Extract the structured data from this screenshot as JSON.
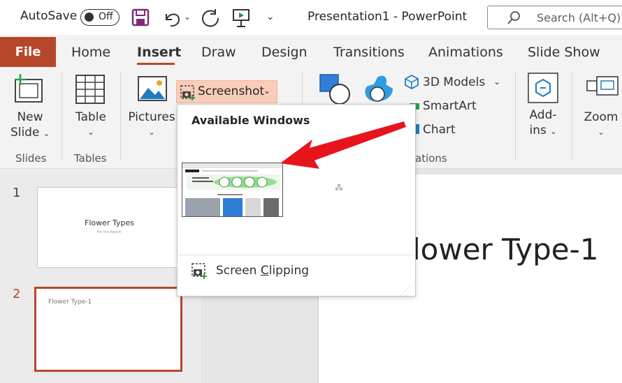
{
  "titlebar": {
    "autosave_label": "AutoSave",
    "autosave_state": "Off",
    "title": "Presentation1  -  PowerPoint",
    "search_placeholder": "Search (Alt+Q)"
  },
  "tabs": {
    "file": "File",
    "items": [
      "Home",
      "Insert",
      "Draw",
      "Design",
      "Transitions",
      "Animations",
      "Slide Show"
    ],
    "active": "Insert"
  },
  "ribbon": {
    "new_slide": [
      "New",
      "Slide"
    ],
    "table": "Table",
    "pictures": "Pictures",
    "screenshot": "Screenshot",
    "models_3d": "3D Models",
    "smartart": "SmartArt",
    "chart": "Chart",
    "addins": [
      "Add-",
      "ins"
    ],
    "zoom": "Zoom",
    "groups": {
      "slides": "Slides",
      "tables": "Tables",
      "illustrations_fragment": "ations"
    }
  },
  "dropdown": {
    "title": "Available Windows",
    "screen_clipping_pre": "Screen ",
    "screen_clipping_accel": "C",
    "screen_clipping_post": "lipping"
  },
  "slides": {
    "numbers": [
      "1",
      "2"
    ],
    "slide1_title": "Flower Types",
    "slide1_subtitle": "For the Ayesh!",
    "slide2_title": "Flower Type-1"
  },
  "main_slide": {
    "title": "lower Type-1"
  },
  "colors": {
    "accent": "#b7472a",
    "screenshot_highlight": "#f9cdb9",
    "arrow": "#e8141c"
  }
}
